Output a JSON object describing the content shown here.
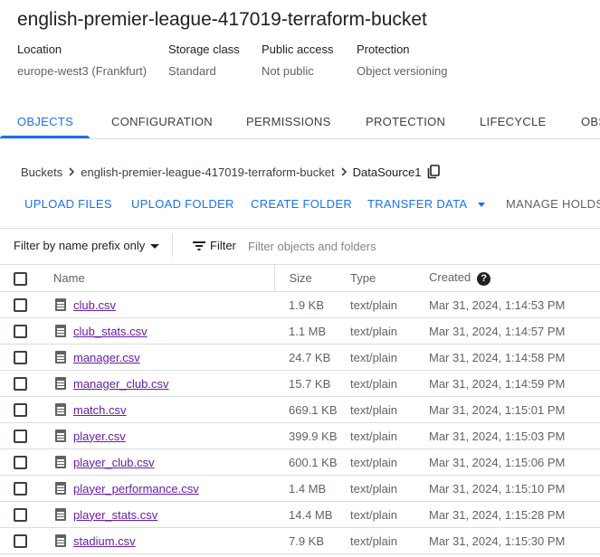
{
  "bucket": {
    "title": "english-premier-league-417019-terraform-bucket"
  },
  "meta": [
    {
      "label": "Location",
      "value": "europe-west3 (Frankfurt)"
    },
    {
      "label": "Storage class",
      "value": "Standard"
    },
    {
      "label": "Public access",
      "value": "Not public"
    },
    {
      "label": "Protection",
      "value": "Object versioning"
    }
  ],
  "tabs": [
    {
      "label": "OBJECTS",
      "active": true
    },
    {
      "label": "CONFIGURATION"
    },
    {
      "label": "PERMISSIONS"
    },
    {
      "label": "PROTECTION"
    },
    {
      "label": "LIFECYCLE"
    },
    {
      "label": "OBS"
    }
  ],
  "breadcrumb": {
    "root": "Buckets",
    "bucket": "english-premier-league-417019-terraform-bucket",
    "folder": "DataSource1"
  },
  "actions": {
    "upload_files": "UPLOAD FILES",
    "upload_folder": "UPLOAD FOLDER",
    "create_folder": "CREATE FOLDER",
    "transfer_data": "TRANSFER DATA",
    "manage_holds": "MANAGE HOLDS"
  },
  "filter": {
    "prefix_label": "Filter by name prefix only",
    "label": "Filter",
    "placeholder": "Filter objects and folders"
  },
  "table": {
    "columns": {
      "name": "Name",
      "size": "Size",
      "type": "Type",
      "created": "Created"
    },
    "rows": [
      {
        "name": "club.csv",
        "size": "1.9 KB",
        "type": "text/plain",
        "created": "Mar 31, 2024, 1:14:53 PM"
      },
      {
        "name": "club_stats.csv",
        "size": "1.1 MB",
        "type": "text/plain",
        "created": "Mar 31, 2024, 1:14:57 PM"
      },
      {
        "name": "manager.csv",
        "size": "24.7 KB",
        "type": "text/plain",
        "created": "Mar 31, 2024, 1:14:58 PM"
      },
      {
        "name": "manager_club.csv",
        "size": "15.7 KB",
        "type": "text/plain",
        "created": "Mar 31, 2024, 1:14:59 PM"
      },
      {
        "name": "match.csv",
        "size": "669.1 KB",
        "type": "text/plain",
        "created": "Mar 31, 2024, 1:15:01 PM"
      },
      {
        "name": "player.csv",
        "size": "399.9 KB",
        "type": "text/plain",
        "created": "Mar 31, 2024, 1:15:03 PM"
      },
      {
        "name": "player_club.csv",
        "size": "600.1 KB",
        "type": "text/plain",
        "created": "Mar 31, 2024, 1:15:06 PM"
      },
      {
        "name": "player_performance.csv",
        "size": "1.4 MB",
        "type": "text/plain",
        "created": "Mar 31, 2024, 1:15:10 PM"
      },
      {
        "name": "player_stats.csv",
        "size": "14.4 MB",
        "type": "text/plain",
        "created": "Mar 31, 2024, 1:15:28 PM"
      },
      {
        "name": "stadium.csv",
        "size": "7.9 KB",
        "type": "text/plain",
        "created": "Mar 31, 2024, 1:15:30 PM"
      }
    ]
  },
  "colors": {
    "accent": "#1a73e8",
    "visited_link": "#681da8",
    "muted_text": "#5f6368",
    "divider": "#dadce0"
  }
}
